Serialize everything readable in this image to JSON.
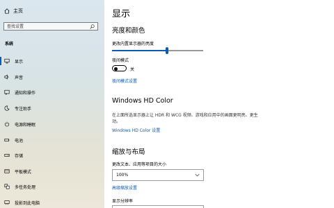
{
  "sidebar": {
    "home_label": "主页",
    "search_placeholder": "查找设置",
    "section_label": "系统",
    "items": [
      {
        "label": "显示",
        "icon": "monitor-icon"
      },
      {
        "label": "声音",
        "icon": "speaker-icon"
      },
      {
        "label": "通知和操作",
        "icon": "notification-icon"
      },
      {
        "label": "专注助手",
        "icon": "moon-icon"
      },
      {
        "label": "电源和睡眠",
        "icon": "power-icon"
      },
      {
        "label": "电池",
        "icon": "battery-icon"
      },
      {
        "label": "存储",
        "icon": "storage-icon"
      },
      {
        "label": "平板模式",
        "icon": "tablet-icon"
      },
      {
        "label": "多任务处理",
        "icon": "multitask-icon"
      },
      {
        "label": "投影到此电脑",
        "icon": "projector-icon"
      }
    ],
    "selected_index": 0
  },
  "main": {
    "title": "显示",
    "brightness_section": {
      "heading": "亮度和颜色",
      "brightness_label": "更改内置显示器的亮度",
      "brightness_value": 0.6,
      "night_light_label": "夜间模式",
      "night_light_state": "关",
      "night_light_link": "夜间模式设置"
    },
    "hdr_section": {
      "heading": "Windows HD Color",
      "description": "在上面所选显示器上让 HDR 和 WCG 视频、游戏和应用中的画面更明亮、更生动。",
      "link": "Windows HD Color 设置"
    },
    "scale_section": {
      "heading": "缩放与布局",
      "scale_label": "更改文本、应用等项目的大小",
      "scale_value": "100%",
      "advanced_link": "高级缩放设置",
      "resolution_label": "显示分辨率"
    }
  },
  "colors": {
    "accent": "#0b5cad"
  }
}
